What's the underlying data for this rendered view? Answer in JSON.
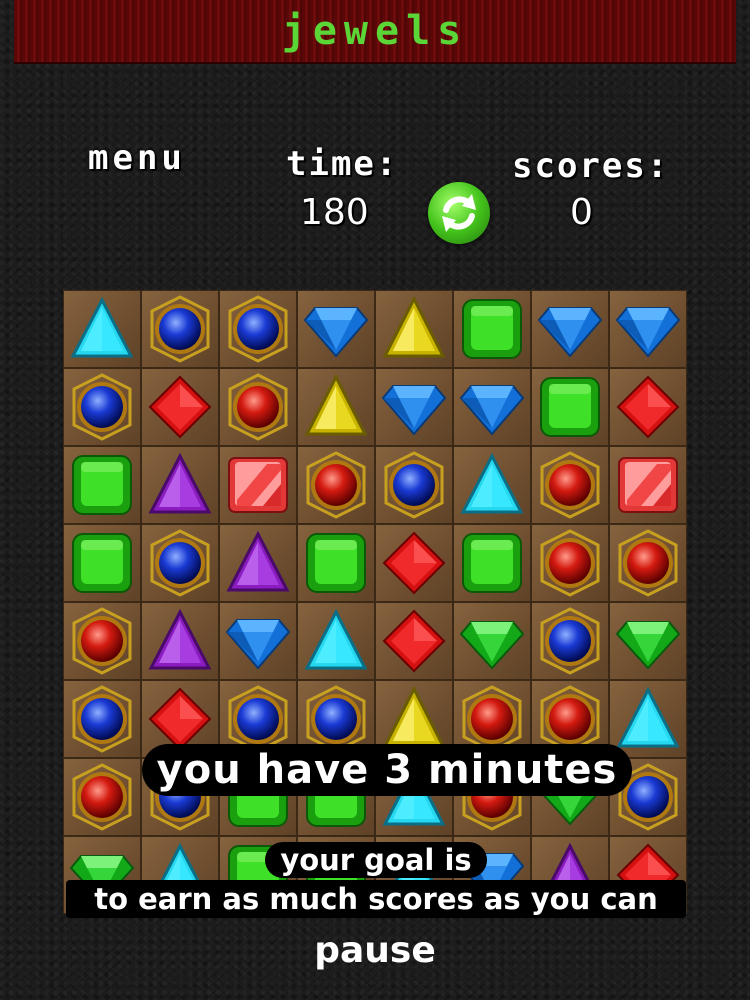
{
  "header": {
    "title": "jewels"
  },
  "hud": {
    "menu_label": "menu",
    "time_label": "time:",
    "time_value": "180",
    "scores_label": "scores:",
    "scores_value": "0",
    "refresh_icon": "refresh-icon"
  },
  "board": {
    "rows": [
      [
        "cyan-triangle",
        "blue-orb",
        "blue-orb",
        "blue-diamond",
        "yellow-triangle",
        "green-square",
        "blue-diamond",
        "blue-diamond"
      ],
      [
        "blue-orb",
        "red-diamond",
        "red-orb",
        "yellow-triangle",
        "blue-diamond",
        "blue-diamond",
        "green-square",
        "red-diamond"
      ],
      [
        "green-square",
        "purple-triangle",
        "pink-square",
        "red-orb",
        "blue-orb",
        "cyan-triangle",
        "red-orb",
        "pink-square"
      ],
      [
        "green-square",
        "blue-orb",
        "purple-triangle",
        "green-square",
        "red-diamond",
        "green-square",
        "red-orb",
        "red-orb"
      ],
      [
        "red-orb",
        "purple-triangle",
        "blue-diamond",
        "cyan-triangle",
        "red-diamond",
        "green-emerald",
        "blue-orb",
        "green-emerald"
      ],
      [
        "blue-orb",
        "red-diamond",
        "blue-orb",
        "blue-orb",
        "yellow-triangle",
        "red-orb",
        "red-orb",
        "cyan-triangle"
      ],
      [
        "red-orb",
        "blue-orb",
        "green-square",
        "green-square",
        "cyan-triangle",
        "red-orb",
        "green-emerald",
        "blue-orb"
      ],
      [
        "green-emerald",
        "cyan-triangle",
        "green-square",
        "green-square",
        "cyan-triangle",
        "blue-diamond",
        "purple-triangle",
        "red-diamond"
      ]
    ]
  },
  "overlay": {
    "message_main": "you have 3 minutes",
    "message_goal": "your goal is",
    "message_earn": "to earn as much scores as you can"
  },
  "footer": {
    "pause_label": "pause"
  },
  "colors": {
    "title_green": "#5ad636",
    "titlebar_red": "#5a0708",
    "board_brown": "#6b4a2a"
  }
}
